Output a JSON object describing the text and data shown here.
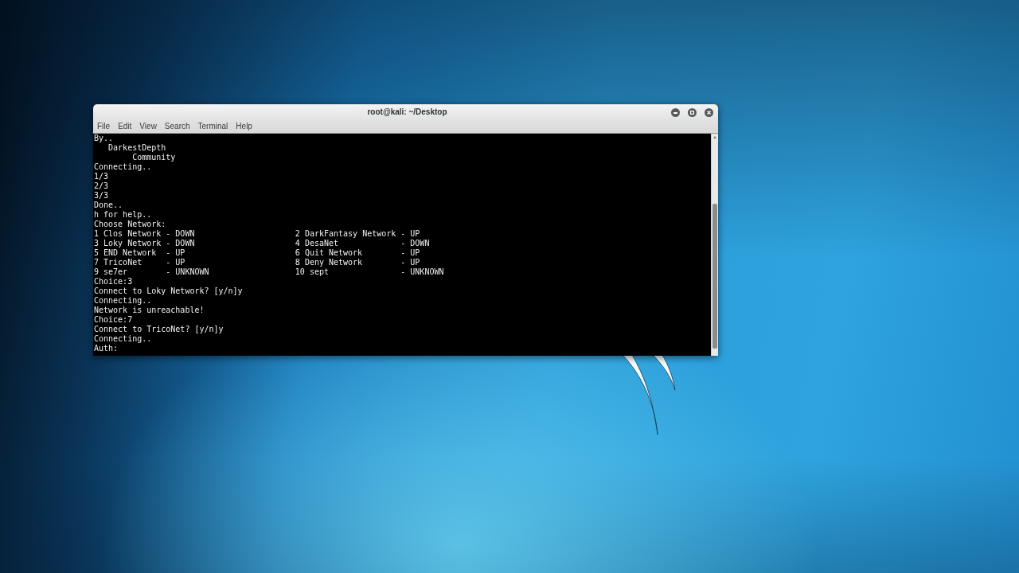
{
  "window": {
    "title": "root@kali: ~/Desktop"
  },
  "menu_bar": [
    "File",
    "Edit",
    "View",
    "Search",
    "Terminal",
    "Help"
  ],
  "terminal": {
    "lines": [
      {
        "kind": "text",
        "text": "By.."
      },
      {
        "kind": "text",
        "text": "   DarkestDepth"
      },
      {
        "kind": "text",
        "text": "        Community"
      },
      {
        "kind": "text",
        "text": "Connecting.."
      },
      {
        "kind": "text",
        "text": "1/3"
      },
      {
        "kind": "text",
        "text": "2/3"
      },
      {
        "kind": "text",
        "text": "3/3"
      },
      {
        "kind": "text",
        "text": "Done.."
      },
      {
        "kind": "text",
        "text": "h for help.."
      },
      {
        "kind": "text",
        "text": "Choose Network:"
      },
      {
        "kind": "network_row",
        "left": {
          "label": "1 Clos Network",
          "status": "- DOWN"
        },
        "right": {
          "label": "2 DarkFantasy Network",
          "status": "- UP"
        }
      },
      {
        "kind": "network_row",
        "left": {
          "label": "3 Loky Network",
          "status": "- DOWN"
        },
        "right": {
          "label": "4 DesaNet",
          "status": "- DOWN"
        }
      },
      {
        "kind": "network_row",
        "left": {
          "label": "5 END Network",
          "status": "- UP"
        },
        "right": {
          "label": "6 Quit Network",
          "status": "- UP"
        }
      },
      {
        "kind": "network_row",
        "left": {
          "label": "7 TricoNet",
          "status": "- UP"
        },
        "right": {
          "label": "8 Deny Network",
          "status": "- UP"
        }
      },
      {
        "kind": "network_row",
        "left": {
          "label": "9 se7er",
          "status": "- UNKNOWN"
        },
        "right": {
          "label": "10 sept",
          "status": "- UNKNOWN"
        }
      },
      {
        "kind": "text",
        "text": "Choice:3"
      },
      {
        "kind": "text",
        "text": "Connect to Loky Network? [y/n]y"
      },
      {
        "kind": "text",
        "text": "Connecting.."
      },
      {
        "kind": "text",
        "text": "Network is unreachable!"
      },
      {
        "kind": "text",
        "text": "Choice:7"
      },
      {
        "kind": "text",
        "text": "Connect to TricoNet? [y/n]y"
      },
      {
        "kind": "text",
        "text": "Connecting.."
      },
      {
        "kind": "text",
        "text": "Auth:"
      }
    ]
  }
}
